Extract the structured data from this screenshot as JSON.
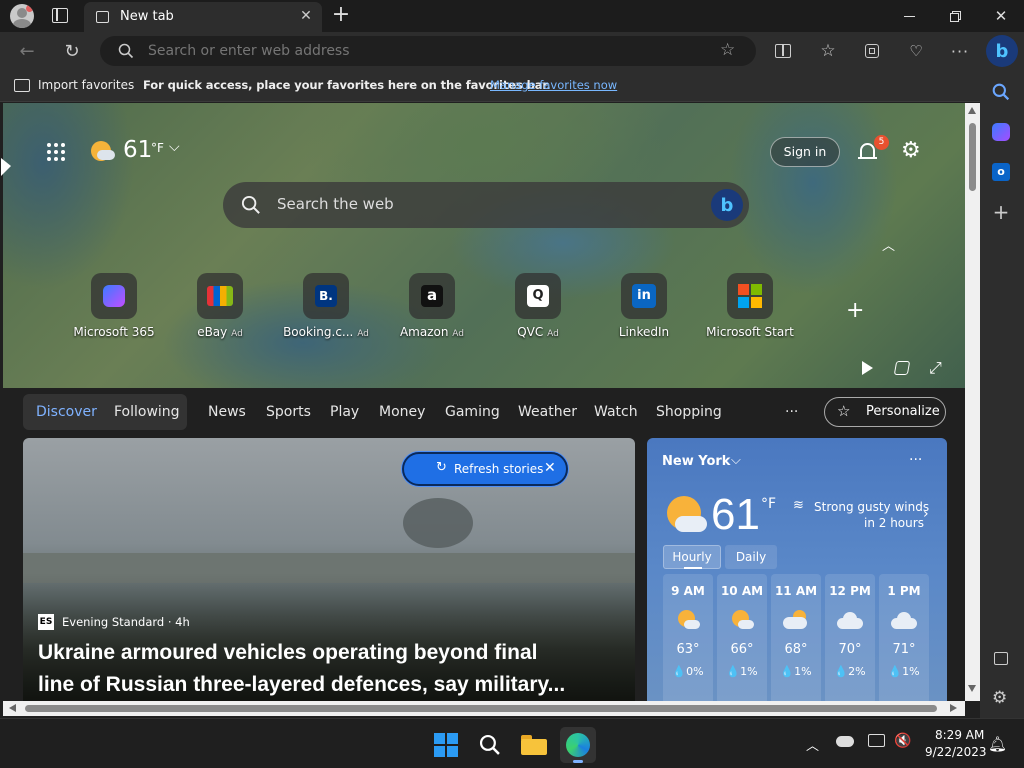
{
  "titlebar": {
    "tab_title": "New tab",
    "new_tab": "+"
  },
  "navbar": {
    "address_placeholder": "Search or enter web address"
  },
  "favorites_bar": {
    "import_label": "Import favorites",
    "hint": "For quick access, place your favorites here on the favorites bar.",
    "manage_link": "Manage favorites now"
  },
  "header": {
    "temperature": "61",
    "unit": "°F",
    "sign_in": "Sign in",
    "notification_count": "5"
  },
  "search": {
    "placeholder": "Search the web"
  },
  "shortcuts": [
    {
      "label": "Microsoft 365",
      "ad": ""
    },
    {
      "label": "eBay",
      "ad": "Ad"
    },
    {
      "label": "Booking.c...",
      "ad": "Ad"
    },
    {
      "label": "Amazon",
      "ad": "Ad"
    },
    {
      "label": "QVC",
      "ad": "Ad"
    },
    {
      "label": "LinkedIn",
      "ad": ""
    },
    {
      "label": "Microsoft Start",
      "ad": ""
    }
  ],
  "feed_nav": {
    "discover": "Discover",
    "following": "Following",
    "items": [
      "News",
      "Sports",
      "Play",
      "Money",
      "Gaming",
      "Weather",
      "Watch",
      "Shopping"
    ],
    "more": "···",
    "personalize": "Personalize"
  },
  "refresh": {
    "label": "Refresh stories"
  },
  "story": {
    "source_logo": "ES",
    "source": "Evening Standard · 4h",
    "headline_line1": "Ukraine armoured vehicles operating beyond final",
    "headline_line2": "line of Russian three-layered defences, say military..."
  },
  "weather": {
    "city": "New York",
    "more": "···",
    "temp": "61",
    "unit": "°F",
    "alert_line1": "Strong gusty winds",
    "alert_line2": "in 2 hours",
    "tab_hourly": "Hourly",
    "tab_daily": "Daily",
    "hours": [
      {
        "time": "9 AM",
        "temp": "63°",
        "precip": "0%",
        "icon": "partly-sunny-icon"
      },
      {
        "time": "10 AM",
        "temp": "66°",
        "precip": "1%",
        "icon": "partly-sunny-icon"
      },
      {
        "time": "11 AM",
        "temp": "68°",
        "precip": "1%",
        "icon": "mostly-cloudy-icon"
      },
      {
        "time": "12 PM",
        "temp": "70°",
        "precip": "2%",
        "icon": "cloudy-icon"
      },
      {
        "time": "1 PM",
        "temp": "71°",
        "precip": "1%",
        "icon": "cloudy-icon"
      }
    ]
  },
  "taskbar": {
    "time": "8:29 AM",
    "date": "9/22/2023"
  },
  "colors": {
    "accent": "#4f8ff7",
    "link": "#78b7ff",
    "badge": "#e8512f"
  }
}
